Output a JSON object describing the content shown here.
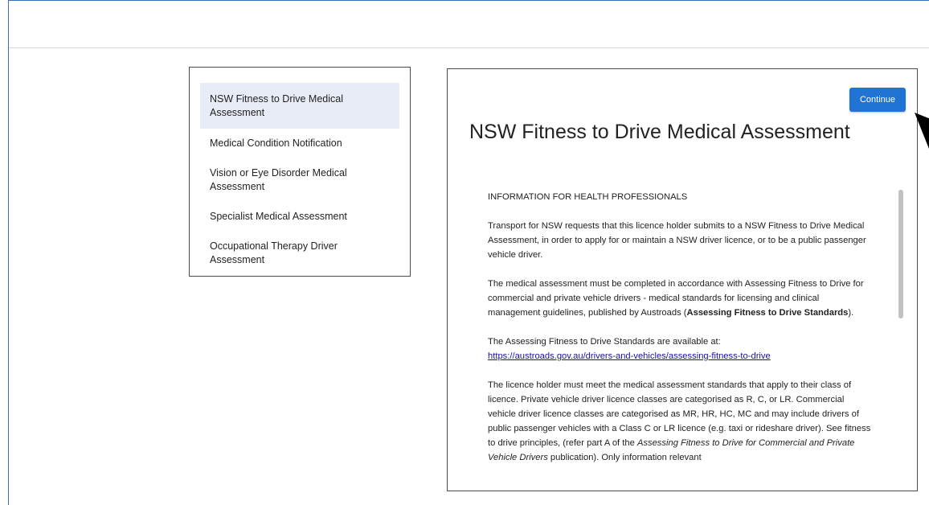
{
  "sidebar": {
    "items": [
      {
        "label": "NSW Fitness to Drive Medical Assessment"
      },
      {
        "label": "Medical Condition Notification"
      },
      {
        "label": "Vision or Eye Disorder Medical Assessment"
      },
      {
        "label": "Specialist Medical Assessment"
      },
      {
        "label": "Occupational Therapy Driver Assessment"
      }
    ]
  },
  "main": {
    "continue_label": "Continue",
    "title": "NSW Fitness to Drive Medical Assessment",
    "heading": "INFORMATION FOR HEALTH PROFESSIONALS",
    "p1": "Transport for NSW requests that this licence holder submits to a NSW Fitness to Drive Medical Assessment, in order to apply for or maintain a NSW driver licence, or to be a public passenger vehicle driver.",
    "p2_text": "The medical assessment must be completed in accordance with Assessing Fitness to Drive for commercial and private vehicle drivers - medical standards for licensing and clinical management guidelines, published by Austroads (",
    "p2_bold": "Assessing Fitness to Drive Standards",
    "p2_end": ").",
    "p3_text": "The Assessing Fitness to Drive Standards are available at:",
    "p3_link": "https://austroads.gov.au/drivers-and-vehicles/assessing-fitness-to-drive",
    "p4_text": "The licence holder must meet the medical assessment standards that apply to their class of licence. Private vehicle driver licence classes are categorised as R, C, or LR. Commercial vehicle driver licence classes are categorised as MR, HR, HC, MC and may include drivers of public passenger vehicles with a Class C or LR licence (e.g. taxi or rideshare driver). See fitness to drive principles, (refer part A of the ",
    "p4_italic": "Assessing Fitness to Drive for Commercial and Private Vehicle Drivers",
    "p4_end": " publication). Only information relevant"
  },
  "colors": {
    "accent": "#1f74d4",
    "active_nav_bg": "#e8ecf6",
    "frame_border": "#3b6fb6",
    "link": "#1a0dab"
  }
}
